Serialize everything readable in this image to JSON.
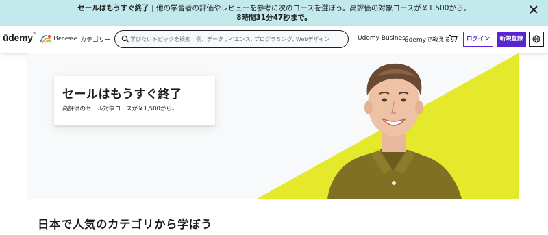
{
  "promo_banner": {
    "headline": "セールはもうすぐ終了",
    "message": " | 他の学習者の評価やレビューを参考に次のコースを選ぼう。高評価の対象コースが￥1,500から。",
    "countdown": "8時間31分47秒まで。",
    "close_icon": "close-icon"
  },
  "header": {
    "logo_udemy": "ūdemy",
    "logo_tm": "™",
    "logo_partner": "Benesse",
    "category_label": "カテゴリー",
    "search": {
      "placeholder": "学びたいトピックを検索　例：データサイエンス, プログラミング, Webデザイン",
      "value": ""
    },
    "business_label": "Udemy Business",
    "teach_label": "Udemyで教える",
    "cart_icon": "cart-icon",
    "login_label": "ログイン",
    "signup_label": "新規登録",
    "language_icon": "globe-icon"
  },
  "hero": {
    "title": "セールはもうすぐ終了",
    "text": "高評価のセール対象コースが￥1,500から。",
    "accent_color": "#e4ea2b"
  },
  "section": {
    "title": "日本で人気のカテゴリから学ぼう"
  },
  "colors": {
    "promo_bg": "#c2e9eb",
    "brand_purple": "#5624d0",
    "text": "#1c1d1f"
  }
}
